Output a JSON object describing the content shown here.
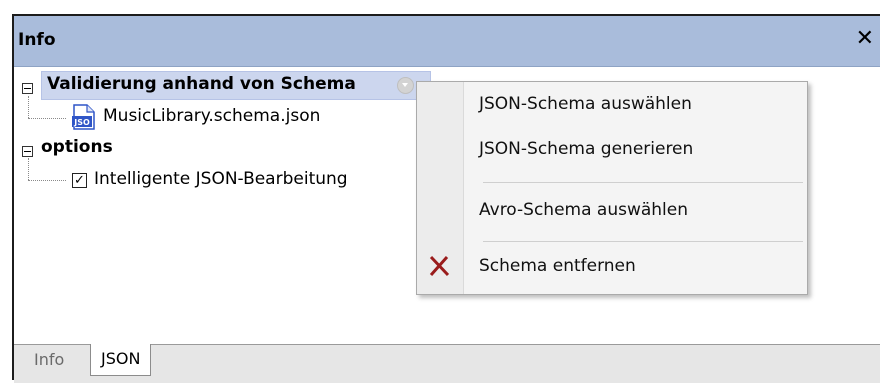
{
  "window": {
    "title": "Info",
    "close_glyph": "✕"
  },
  "tree": {
    "nodes": [
      {
        "label": "Validierung anhand von Schema",
        "type": "group",
        "expanded": true,
        "selected": true,
        "icon": "minus-expander"
      },
      {
        "label": "MusicLibrary.schema.json",
        "type": "file",
        "icon": "json-file-icon",
        "icon_text": "JSO"
      },
      {
        "label": "options",
        "type": "group",
        "expanded": true,
        "icon": "minus-expander"
      },
      {
        "label": "Intelligente JSON-Bearbeitung",
        "type": "checkbox",
        "checked": true,
        "check_glyph": "✓"
      }
    ]
  },
  "tabs": [
    {
      "label": "Info",
      "active": false
    },
    {
      "label": "JSON",
      "active": true
    }
  ],
  "context_menu": {
    "items": [
      {
        "label": "JSON-Schema auswählen"
      },
      {
        "label": "JSON-Schema generieren"
      },
      {
        "label": "Avro-Schema auswählen"
      },
      {
        "label": "Schema entfernen",
        "icon": "red-x-icon"
      }
    ]
  },
  "colors": {
    "titlebar": "#a9bcdb",
    "selection": "#ccd6ee",
    "remove_icon": "#9a1c1c",
    "file_icon": "#2f55c7"
  }
}
